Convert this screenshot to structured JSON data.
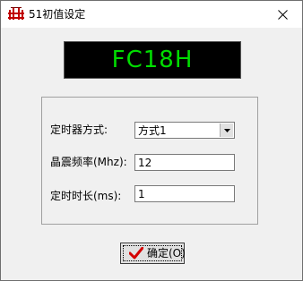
{
  "window": {
    "title": "51初值设定",
    "close_glyph": "✕"
  },
  "display": {
    "value": "FC18H",
    "color": "#00dd00",
    "background": "#000000"
  },
  "form": {
    "timer_mode": {
      "label": "定时器方式:",
      "selected": "方式1"
    },
    "crystal_freq": {
      "label": "晶震频率(Mhz):",
      "value": "12"
    },
    "duration": {
      "label": "定时时长(ms):",
      "value": "1"
    }
  },
  "buttons": {
    "ok": {
      "label": "确定(O)",
      "icon": "check-icon",
      "icon_color": "#d40000"
    }
  }
}
